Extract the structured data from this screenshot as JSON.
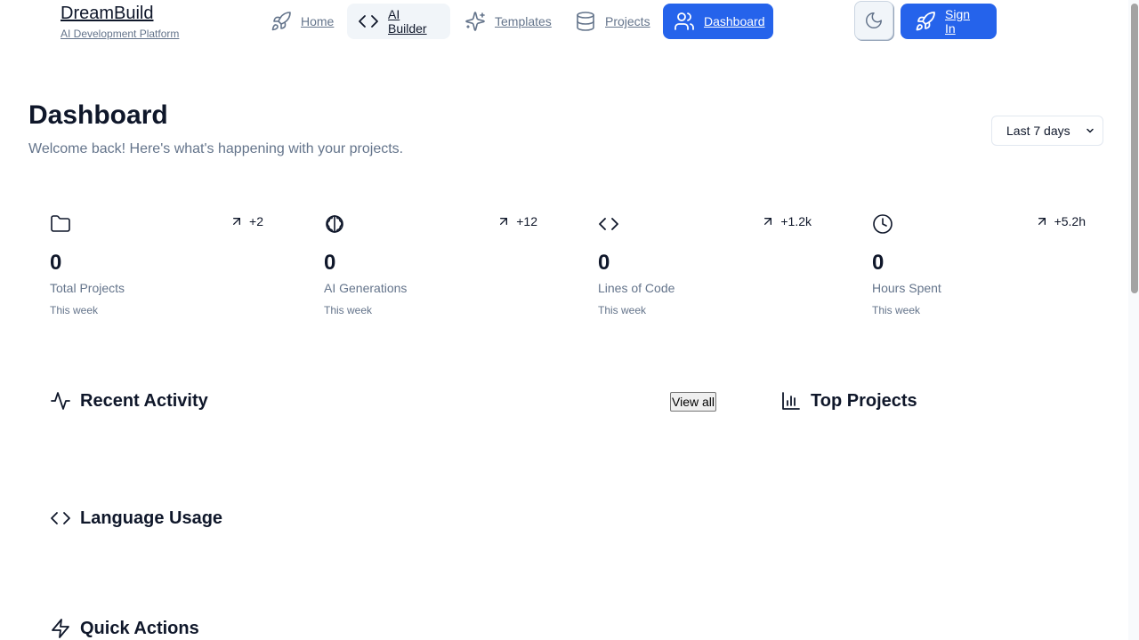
{
  "brand": {
    "title": "DreamBuild",
    "subtitle": "AI Development Platform"
  },
  "nav": {
    "items": [
      {
        "label": "Home",
        "icon": "rocket-icon"
      },
      {
        "label": "AI Builder",
        "icon": "code-icon"
      },
      {
        "label": "Templates",
        "icon": "sparkles-icon"
      },
      {
        "label": "Projects",
        "icon": "database-icon"
      },
      {
        "label": "Dashboard",
        "icon": "users-icon"
      }
    ],
    "active": "AI Builder",
    "current": "Dashboard"
  },
  "header_actions": {
    "theme_icon": "moon-icon",
    "signin_label": "Sign In"
  },
  "page": {
    "title": "Dashboard",
    "subtitle": "Welcome back! Here's what's happening with your projects.",
    "range_selected": "Last 7 days"
  },
  "stats": [
    {
      "icon": "folder-icon",
      "trend": "+2",
      "value": "0",
      "label": "Total Projects",
      "period": "This week"
    },
    {
      "icon": "brain-icon",
      "trend": "+12",
      "value": "0",
      "label": "AI Generations",
      "period": "This week"
    },
    {
      "icon": "code-icon",
      "trend": "+1.2k",
      "value": "0",
      "label": "Lines of Code",
      "period": "This week"
    },
    {
      "icon": "clock-icon",
      "trend": "+5.2h",
      "value": "0",
      "label": "Hours Spent",
      "period": "This week"
    }
  ],
  "sections": {
    "recent_activity": {
      "title": "Recent Activity",
      "icon": "activity-icon",
      "view_all": "View all"
    },
    "top_projects": {
      "title": "Top Projects",
      "icon": "bar-chart-icon"
    },
    "language_usage": {
      "title": "Language Usage",
      "icon": "code-icon"
    },
    "quick_actions": {
      "title": "Quick Actions",
      "icon": "zap-icon"
    }
  },
  "colors": {
    "primary": "#2563eb",
    "muted": "#64748b",
    "text": "#0f172a",
    "active_bg": "#f1f5f9"
  }
}
